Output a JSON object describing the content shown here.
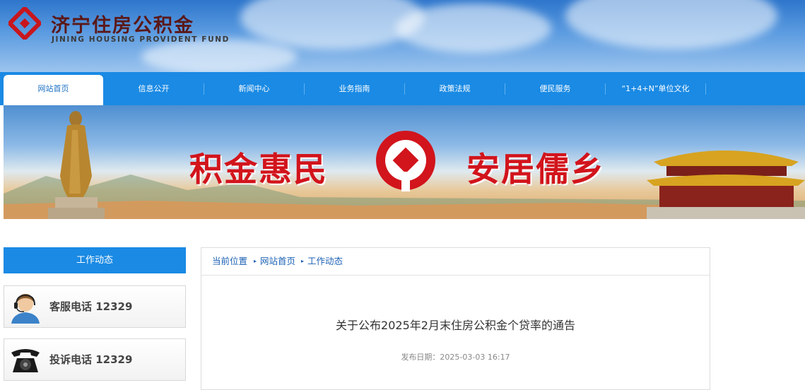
{
  "header": {
    "logo_title": "济宁住房公积金",
    "logo_subtitle": "JINING HOUSING PROVIDENT FUND"
  },
  "nav": {
    "items": [
      {
        "label": "网站首页",
        "active": true
      },
      {
        "label": "信息公开"
      },
      {
        "label": "新闻中心"
      },
      {
        "label": "业务指南"
      },
      {
        "label": "政策法规"
      },
      {
        "label": "便民服务"
      },
      {
        "label": "“1+4+N”单位文化"
      }
    ]
  },
  "banner": {
    "left_slogan": "积金惠民",
    "right_slogan": "安居儒乡"
  },
  "sidebar": {
    "title": "工作动态",
    "service_phone": "客服电话 12329",
    "complaint_phone": "投诉电话 12329"
  },
  "content": {
    "breadcrumb": [
      "当前位置",
      "网站首页",
      "工作动态"
    ],
    "title": "关于公布2025年2月末住房公积金个贷率的通告",
    "date": "发布日期：2025-03-03 16:17"
  },
  "colors": {
    "nav_blue": "#1a8ae4",
    "brand_red": "#d2141c",
    "link_blue": "#1d62b5"
  },
  "icons": [
    "logo-mark-icon",
    "banner-logo-icon",
    "headset-agent-icon",
    "telephone-icon",
    "breadcrumb-arrow-icon"
  ]
}
